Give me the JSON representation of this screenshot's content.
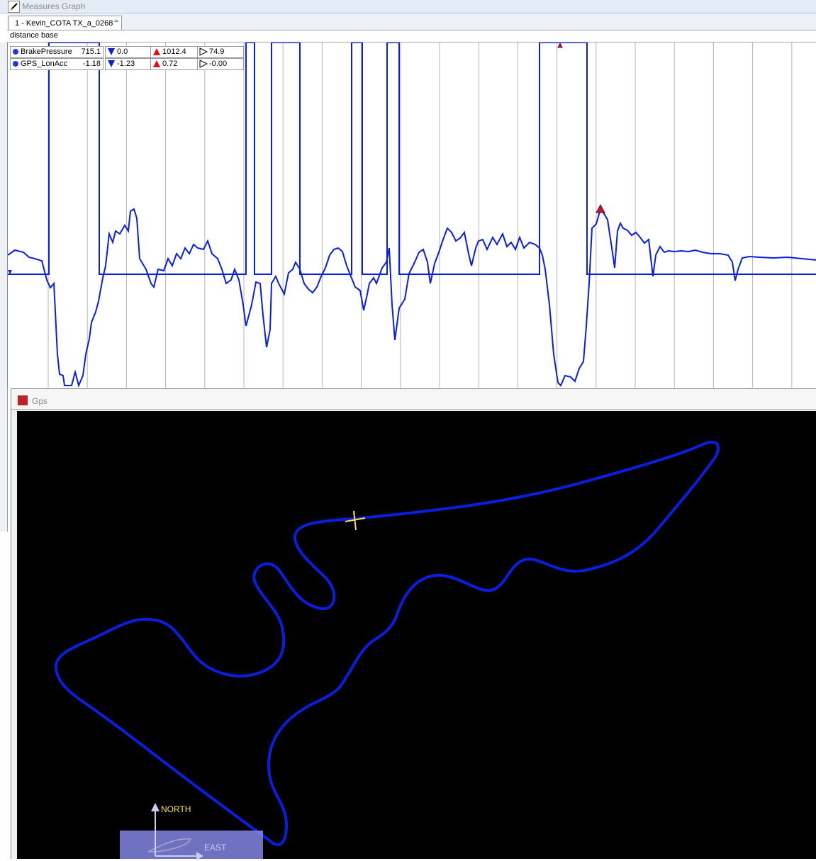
{
  "measures_window": {
    "title": "Measures Graph",
    "tab_label": "1 - Kevin_COTA TX_a_0268",
    "tab_close": "≈",
    "base_label": "distance base"
  },
  "legend": [
    {
      "name": "BrakePressure",
      "value": "715.1",
      "min": "0.0",
      "max": "1012.4",
      "avg": "74.9"
    },
    {
      "name": "GPS_LonAcc",
      "value": "-1.18",
      "min": "-1.23",
      "max": "0.72",
      "avg": "-0.00"
    }
  ],
  "gps_window": {
    "title": "Gps",
    "north_label": "NORTH",
    "east_label": "EAST"
  },
  "colors": {
    "trace": "#0a1ee0",
    "marker_max": "#e01010",
    "cursor": "#ffe24d"
  }
}
